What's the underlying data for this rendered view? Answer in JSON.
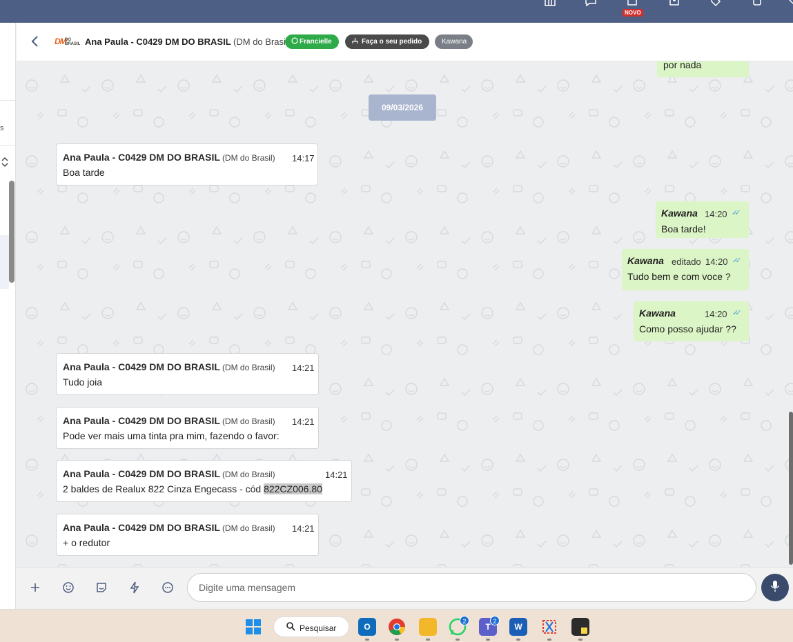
{
  "topbar": {
    "badge_new": "NOVO",
    "icons": [
      "columns-icon",
      "chat-bubble-icon",
      "bookmark-icon",
      "contact-card-icon",
      "tag-icon",
      "phone-icon",
      "close-icon"
    ]
  },
  "leftstrip": {
    "fragment_text": "s"
  },
  "header": {
    "contact_name": "Ana Paula - C0429 DM DO BRASIL",
    "contact_company": "(DM do Brasil)",
    "logo_text_main": "DM",
    "logo_text_small": "DO BRASIL",
    "tag_whatsapp": "Francielle",
    "tag_order": "Faça o seu pedido",
    "tag_agent": "Kawana"
  },
  "chat": {
    "date_separator": "09/03/2026",
    "partial_top_message": "por nada",
    "incoming": [
      {
        "name": "Ana Paula - C0429 DM DO BRASIL",
        "company": "(DM do Brasil)",
        "time": "14:17",
        "text": "Boa tarde"
      },
      {
        "name": "Ana Paula - C0429 DM DO BRASIL",
        "company": "(DM do Brasil)",
        "time": "14:21",
        "text": "Tudo joia"
      },
      {
        "name": "Ana Paula - C0429 DM DO BRASIL",
        "company": "(DM do Brasil)",
        "time": "14:21",
        "text": "Pode ver mais uma tinta pra mim, fazendo o favor:"
      },
      {
        "name": "Ana Paula - C0429 DM DO BRASIL",
        "company": "(DM do Brasil)",
        "time": "14:21",
        "text_prefix": "2 baldes de Realux 822 Cinza Engecass - cód ",
        "text_highlight": "822CZ006.80"
      },
      {
        "name": "Ana Paula - C0429 DM DO BRASIL",
        "company": "(DM do Brasil)",
        "time": "14:21",
        "text": "+ o redutor"
      }
    ],
    "outgoing": [
      {
        "name": "Kawana",
        "edited": "",
        "time": "14:20",
        "text": "Boa tarde!"
      },
      {
        "name": "Kawana",
        "edited": "editado",
        "time": "14:20",
        "text": "Tudo bem e com voce ?"
      },
      {
        "name": "Kawana",
        "edited": "",
        "time": "14:20",
        "text": "Como posso ajudar ??"
      }
    ]
  },
  "composer": {
    "placeholder": "Digite uma mensagem",
    "icons": [
      "plus-icon",
      "emoji-icon",
      "sticker-icon",
      "lightning-icon",
      "chat-template-icon",
      "microphone-icon"
    ]
  },
  "taskbar": {
    "search_label": "Pesquisar",
    "whatsapp_badge": "2",
    "teams_badge": "2",
    "apps": [
      "outlook",
      "chrome",
      "file-explorer",
      "whatsapp",
      "teams",
      "word",
      "snipping-tool",
      "sticky-notes"
    ]
  },
  "colors": {
    "header_bar": "#4d5f85",
    "incoming_bubble": "#ffffff",
    "outgoing_bubble": "#dcf5c6",
    "pill_green": "#2eaa48",
    "date_chip": "#a9b4ce",
    "mic_button": "#3a4a6c"
  }
}
